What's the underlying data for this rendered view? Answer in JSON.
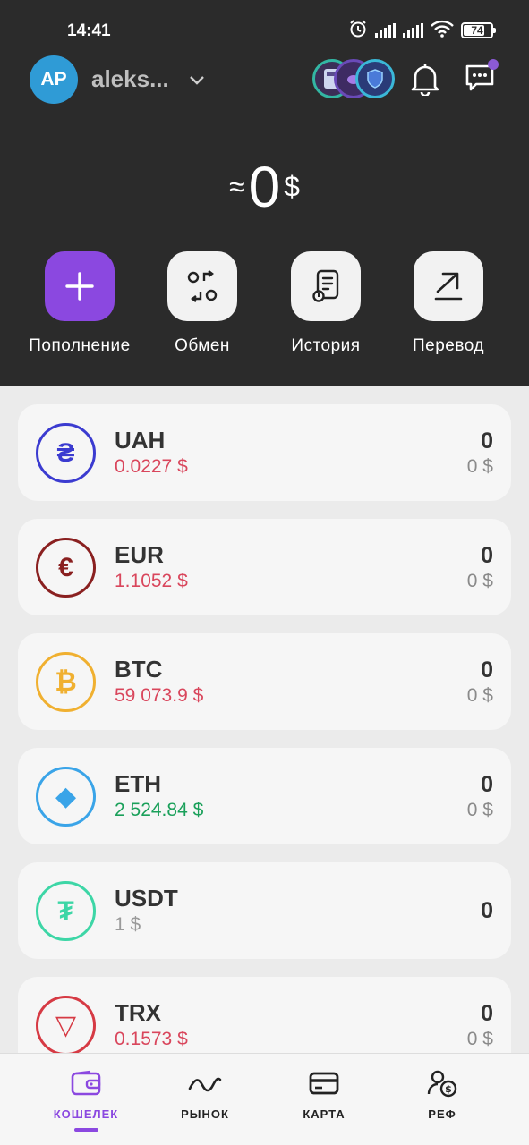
{
  "status_bar": {
    "time": "14:41",
    "battery": "74"
  },
  "header": {
    "avatar_initials": "AP",
    "username": "aleks..."
  },
  "balance": {
    "approx": "≈",
    "amount": "0",
    "currency": "$"
  },
  "actions": [
    {
      "label": "Пополнение"
    },
    {
      "label": "Обмен"
    },
    {
      "label": "История"
    },
    {
      "label": "Перевод"
    }
  ],
  "assets": [
    {
      "ticker": "UAH",
      "symbol": "₴",
      "price": "0.0227 $",
      "amount": "0",
      "amount_usd": "0 $",
      "icon_color": "#3b3bd0",
      "price_color": "#d9465c"
    },
    {
      "ticker": "EUR",
      "symbol": "€",
      "price": "1.1052 $",
      "amount": "0",
      "amount_usd": "0 $",
      "icon_color": "#8a2020",
      "price_color": "#d9465c"
    },
    {
      "ticker": "BTC",
      "symbol": "₿",
      "price": "59 073.9 $",
      "amount": "0",
      "amount_usd": "0 $",
      "icon_color": "#f0b030",
      "price_color": "#d9465c"
    },
    {
      "ticker": "ETH",
      "symbol": "◆",
      "price": "2 524.84 $",
      "amount": "0",
      "amount_usd": "0 $",
      "icon_color": "#3aa4e8",
      "price_color": "#1aa05a"
    },
    {
      "ticker": "USDT",
      "symbol": "₮",
      "price": "1 $",
      "amount": "0",
      "amount_usd": "",
      "icon_color": "#3dd6a6",
      "price_color": "#9a9a9a"
    },
    {
      "ticker": "TRX",
      "symbol": "▽",
      "price": "0.1573 $",
      "amount": "0",
      "amount_usd": "0 $",
      "icon_color": "#d63a44",
      "price_color": "#d9465c"
    }
  ],
  "nav": [
    {
      "label": "КОШЕЛЕК",
      "active": true
    },
    {
      "label": "РЫНОК",
      "active": false
    },
    {
      "label": "КАРТА",
      "active": false
    },
    {
      "label": "РЕФ",
      "active": false
    }
  ],
  "colors": {
    "accent": "#8b48e0",
    "header_bg": "#2b2b2b",
    "loss": "#d9465c",
    "gain": "#1aa05a"
  }
}
